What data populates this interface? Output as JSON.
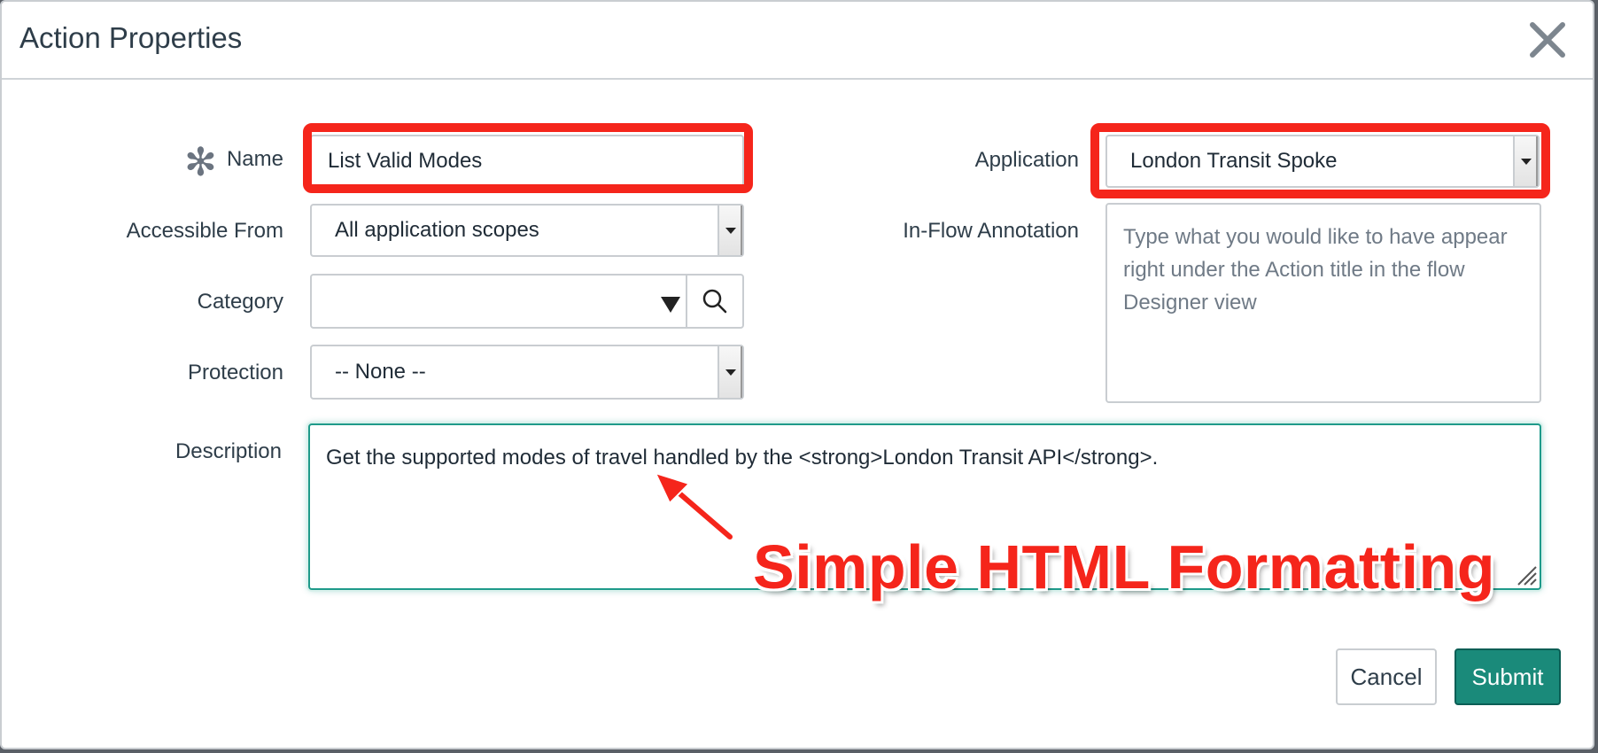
{
  "dialog": {
    "title": "Action Properties",
    "close_icon": "close-icon"
  },
  "form": {
    "name": {
      "label": "Name",
      "required": true,
      "value": "List Valid Modes"
    },
    "accessible_from": {
      "label": "Accessible From",
      "value": "All application scopes"
    },
    "category": {
      "label": "Category",
      "value": ""
    },
    "protection": {
      "label": "Protection",
      "value": "-- None --"
    },
    "description": {
      "label": "Description",
      "value": "Get the supported modes of travel handled by the <strong>London Transit API</strong>."
    },
    "application": {
      "label": "Application",
      "value": "London Transit Spoke"
    },
    "in_flow_annotation": {
      "label": "In-Flow Annotation",
      "placeholder": "Type what you would like to have appear right under the Action title in the flow Designer view"
    }
  },
  "annotation": {
    "text": "Simple HTML Formatting"
  },
  "buttons": {
    "cancel": "Cancel",
    "submit": "Submit"
  },
  "colors": {
    "highlight": "#f5251b",
    "primary": "#1a8a7a",
    "focus_border": "#1f9a8a"
  }
}
